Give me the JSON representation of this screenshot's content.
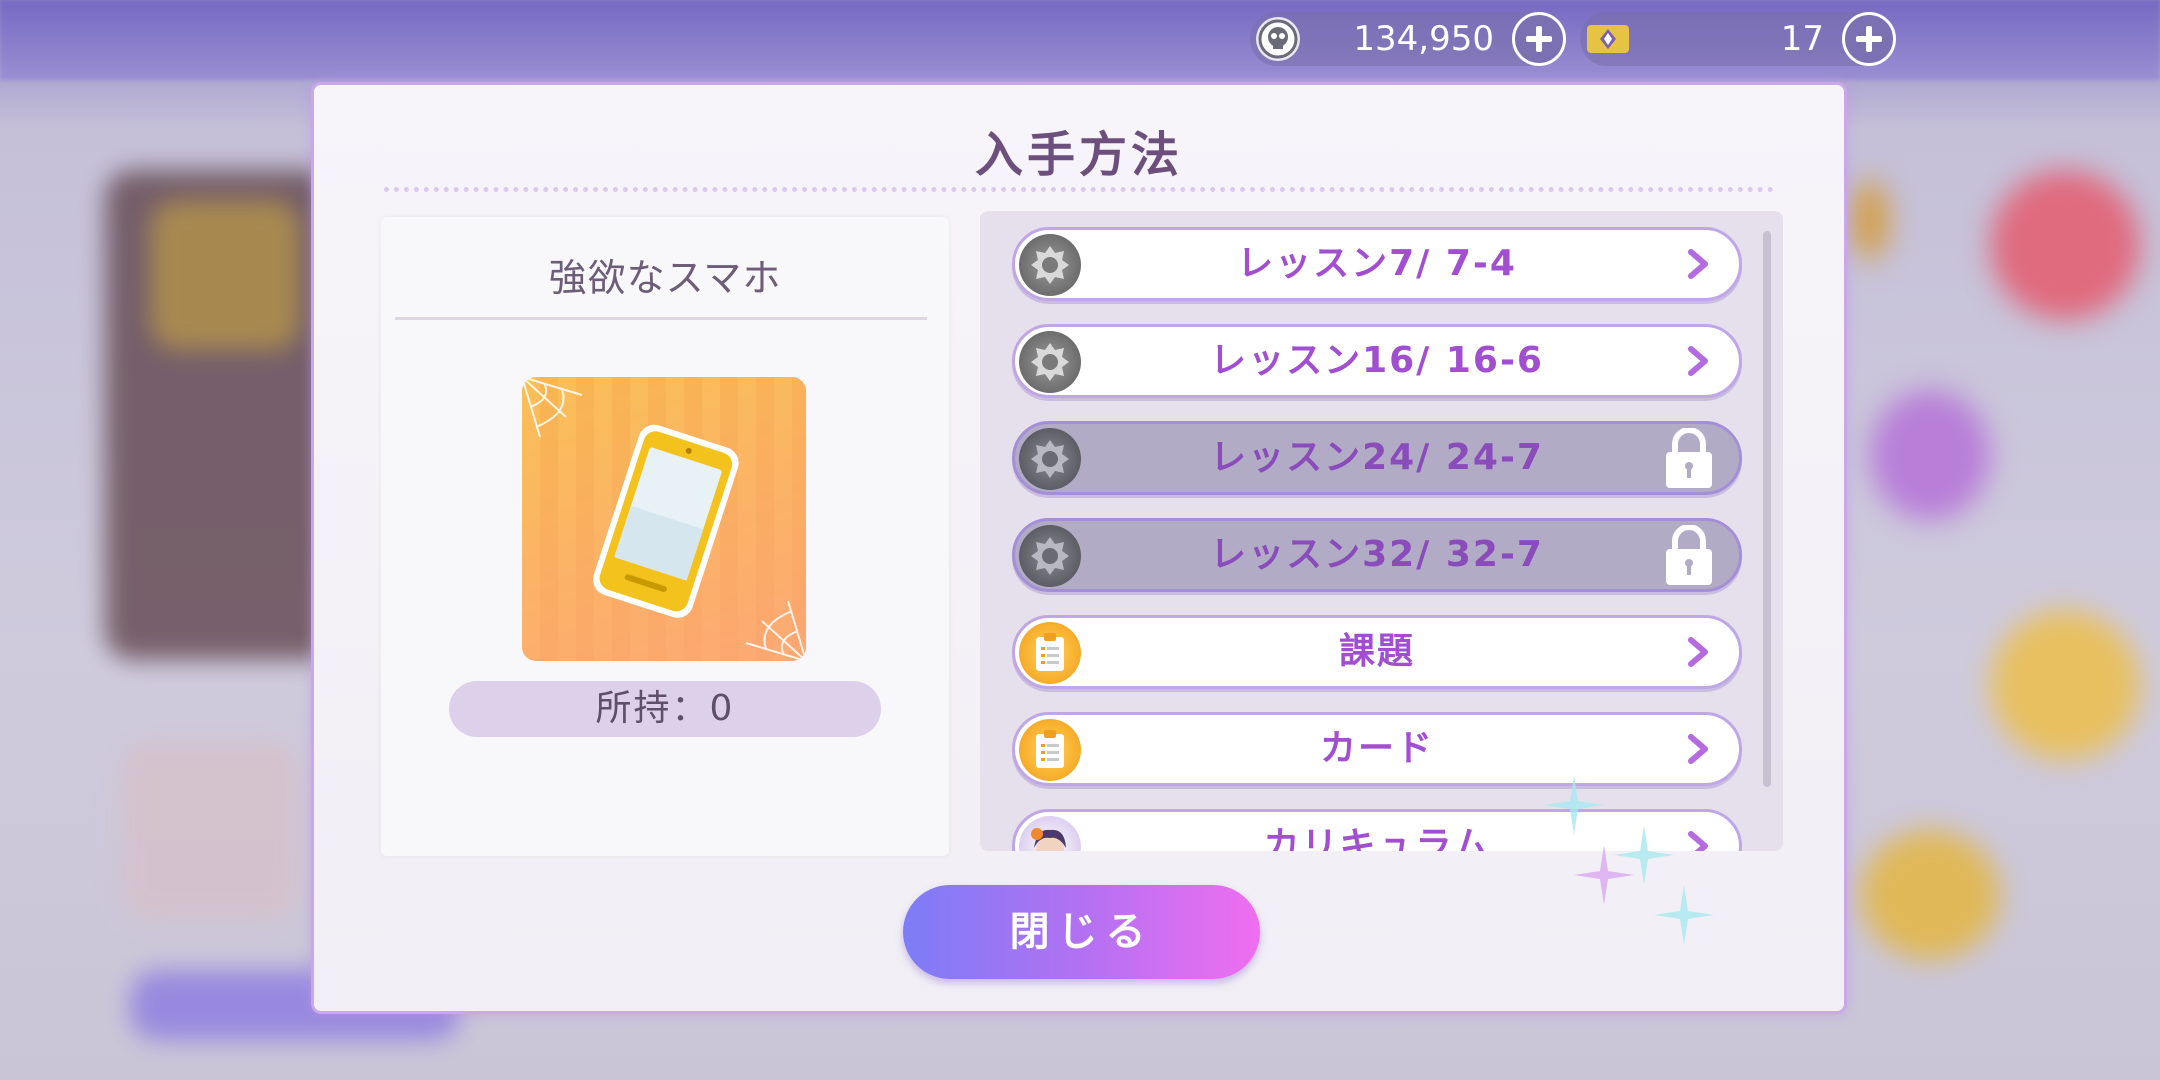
{
  "currency": {
    "coins": {
      "icon": "skull-coin-icon",
      "value": "134,950"
    },
    "gems": {
      "icon": "gem-ticket-icon",
      "value": "17"
    }
  },
  "modal": {
    "title": "入手方法",
    "item": {
      "name": "強欲なスマホ",
      "image_icon": "smartphone-item-icon",
      "owned": "所持：0"
    },
    "sources": [
      {
        "label": "レッスン7/ 7-4",
        "icon": "lesson-medal-icon",
        "locked": false
      },
      {
        "label": "レッスン16/ 16-6",
        "icon": "lesson-medal-icon",
        "locked": false
      },
      {
        "label": "レッスン24/ 24-7",
        "icon": "lesson-medal-icon",
        "locked": true
      },
      {
        "label": "レッスン32/ 32-7",
        "icon": "lesson-medal-icon",
        "locked": true
      },
      {
        "label": "課題",
        "icon": "clipboard-icon",
        "locked": false
      },
      {
        "label": "カード",
        "icon": "clipboard-icon",
        "locked": false
      },
      {
        "label": "カリキュラム",
        "icon": "character-portrait-icon",
        "locked": false
      }
    ],
    "close_label": "閉じる"
  },
  "colors": {
    "accent": "#a14fd0",
    "modal_border": "#c9a8ea",
    "button_start": "#7d7cf6",
    "button_end": "#f06ef0"
  }
}
